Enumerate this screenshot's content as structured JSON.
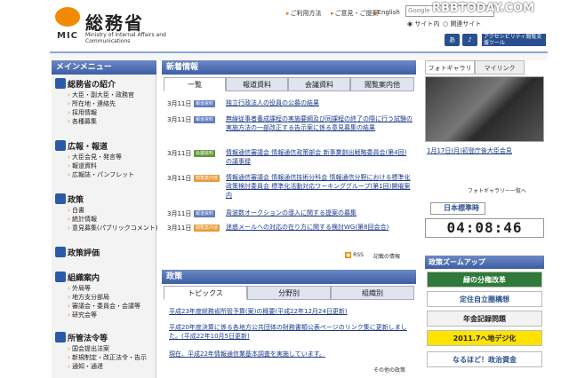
{
  "header": {
    "logo_ja": "総務省",
    "logo_mic": "MIC",
    "logo_en": "Ministry of Internal Affairs and Communications",
    "links": [
      "ご利用方法",
      "ご意見・ご提案",
      "English"
    ],
    "search_placeholder": "Google",
    "radio": [
      "サイト内",
      "関連サイト"
    ],
    "access_label": "アクセシビリティ閲覧支援ツール",
    "watermark": "RBBTODAY.COM"
  },
  "left": {
    "title": "メインメニュー",
    "sections": [
      {
        "title": "総務省の紹介",
        "items": [
          "大臣・副大臣・政務官",
          "所在地・連絡先",
          "採用情報",
          "各種募集"
        ]
      },
      {
        "title": "広報・報道",
        "items": [
          "大臣会見・発言等",
          "報道資料",
          "広報誌・パンフレット"
        ]
      },
      {
        "title": "政策",
        "items": [
          "白書",
          "統計情報",
          "意見募集(パブリックコメント)"
        ]
      },
      {
        "title": "政策評価",
        "items": []
      },
      {
        "title": "組織案内",
        "items": [
          "外局等",
          "地方支分部局",
          "審議会・委員会・会議等",
          "研究会等"
        ]
      },
      {
        "title": "所管法令等",
        "items": [
          "国会提出法案",
          "新規制定・改正法令・告示",
          "通知・通達"
        ]
      }
    ]
  },
  "news": {
    "title": "新着情報",
    "tabs": [
      "一覧",
      "報道資料",
      "会議資料",
      "閲覧案内他"
    ],
    "items": [
      {
        "date": "3月11日",
        "badge": "報道資料",
        "text": "独立行政法人の役員の公募の結果"
      },
      {
        "date": "3月11日",
        "badge": "報道資料",
        "text": "無線従事者養成課程の実施要綱及び同課程の終了の際に行う試験の実施方法の一部改正する告示案に係る意見募集の結果"
      },
      {
        "date": "3月11日",
        "badge": "会議資料",
        "text": "情報通信審議会 情報通信政策部会 新事業創出戦略委員会(第4回)の議事録"
      },
      {
        "date": "3月11日",
        "badge": "閲覧案内他",
        "text": "情報通信審議会 情報通信技術分科会 情報通信分野における標準化政策検討委員会 標準化活動対応ワーキンググループ(第1回)開催案内"
      },
      {
        "date": "3月11日",
        "badge": "報道資料",
        "text": "周波数オークションの導入に関する提案の募集"
      },
      {
        "date": "3月11日",
        "badge": "閲覧案内他",
        "text": "迷惑メールへの対応の在り方に関する検討WG(第8回会合)"
      }
    ],
    "rss": "RSS",
    "more": "記載の情報"
  },
  "policy": {
    "title": "政策",
    "tabs": [
      "トピックス",
      "分野別",
      "組織別"
    ],
    "items": [
      "平成23年度総務省所管予算(案)の概要(平成22年12月24日更新)",
      "平成20年度決算に係る各地方公共団体の財務書類公表ページのリンク集に更新しました。(平成22年10月5日更新)",
      "現在、平成22年情報通信業基本調査を実施しています。"
    ],
    "more": "その他の政策"
  },
  "right": {
    "tabs": [
      "フォトギャラリー",
      "マイリンク"
    ],
    "caption": "1月17日(月)初登庁後大臣会見",
    "gallery_more": "フォトギャラリー一覧へ",
    "jst_label": "日本標準時",
    "clock": "04:08:46",
    "zoom_title": "政策ズームアップ",
    "banners": [
      "緑の分権改革",
      "定住自立圏構想",
      "年金記録問題",
      "2011.7へ地デジ化",
      "なるほど！政治資金"
    ]
  }
}
